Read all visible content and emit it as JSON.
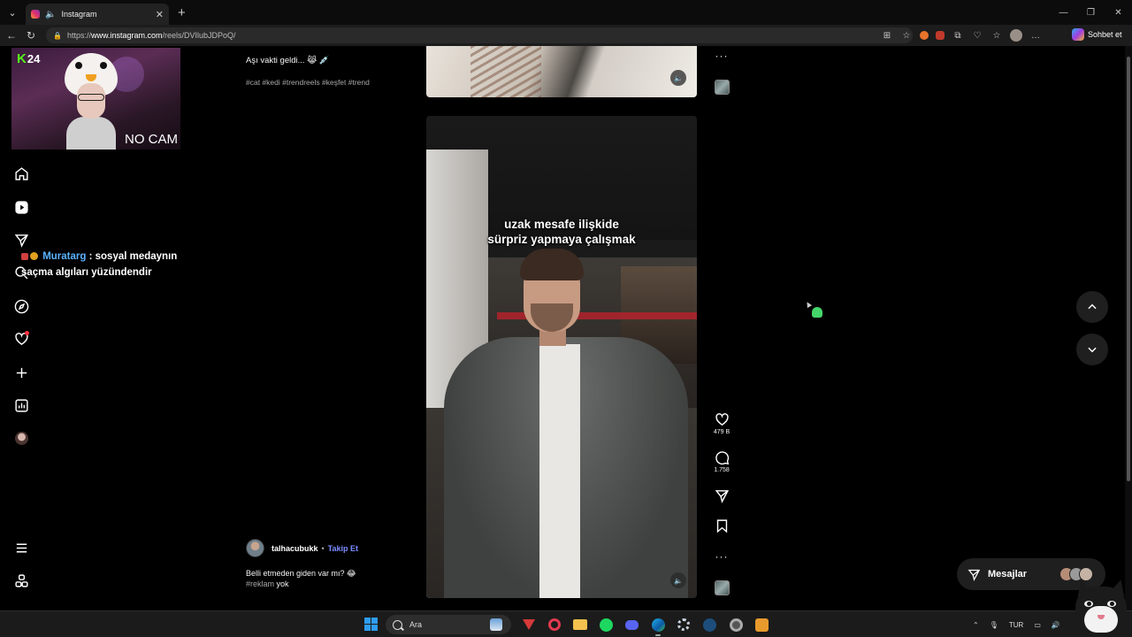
{
  "browser": {
    "tab": {
      "title": "Instagram",
      "favicon": "instagram-icon"
    },
    "url": {
      "prefix": "https://",
      "host": "www.instagram.com",
      "path": "/reels/DVIlubJDPoQ/"
    },
    "copilot_label": "Sohbet et",
    "window_controls": [
      "minimize-icon",
      "maximize-icon",
      "close-icon"
    ]
  },
  "overlay": {
    "webcam": {
      "channel_number": "24",
      "nocam_text": "NO CAM"
    },
    "chat": {
      "username": "Muratarg",
      "message": " : sosyal medaynın saçma algıları yüzündendir"
    }
  },
  "sidenav": {
    "items": [
      "home-icon",
      "reels-icon",
      "direct-icon",
      "search-icon",
      "explore-icon",
      "notifications-icon",
      "create-icon",
      "dashboard-icon",
      "profile-icon",
      "more-icon",
      "meta-icon"
    ]
  },
  "previous_reel": {
    "caption": "Aşı vakti geldi... 😹 💉",
    "hashtags": "#cat #kedi #trendreels #keşfet #trend"
  },
  "current_reel": {
    "overlay_text_line1": "uzak mesafe ilişkide",
    "overlay_text_line2": "sürpriz yapmaya çalışmak",
    "author": "talhacubukk",
    "separator": "•",
    "follow_label": "Takip Et",
    "caption": "Belli etmeden giden var mı? 😂",
    "caption_tag": "#reklam",
    "caption_tail": " yok",
    "likes": "479 B",
    "comments": "1.758"
  },
  "messages": {
    "label": "Mesajlar"
  },
  "taskbar": {
    "search_placeholder": "Ara",
    "language": "TUR",
    "apps": [
      "windows-start-icon",
      "search-icon",
      "vivaldi-icon",
      "opera-icon",
      "file-explorer-icon",
      "spotify-icon",
      "discord-icon",
      "edge-icon",
      "settings-icon",
      "steam-icon",
      "chrome-icon",
      "app-icon"
    ]
  },
  "colors": {
    "accent_follow": "#7a8cff",
    "chat_user": "#5ab1ff",
    "kick_green": "#53fc18",
    "notification": "#ff3040"
  }
}
